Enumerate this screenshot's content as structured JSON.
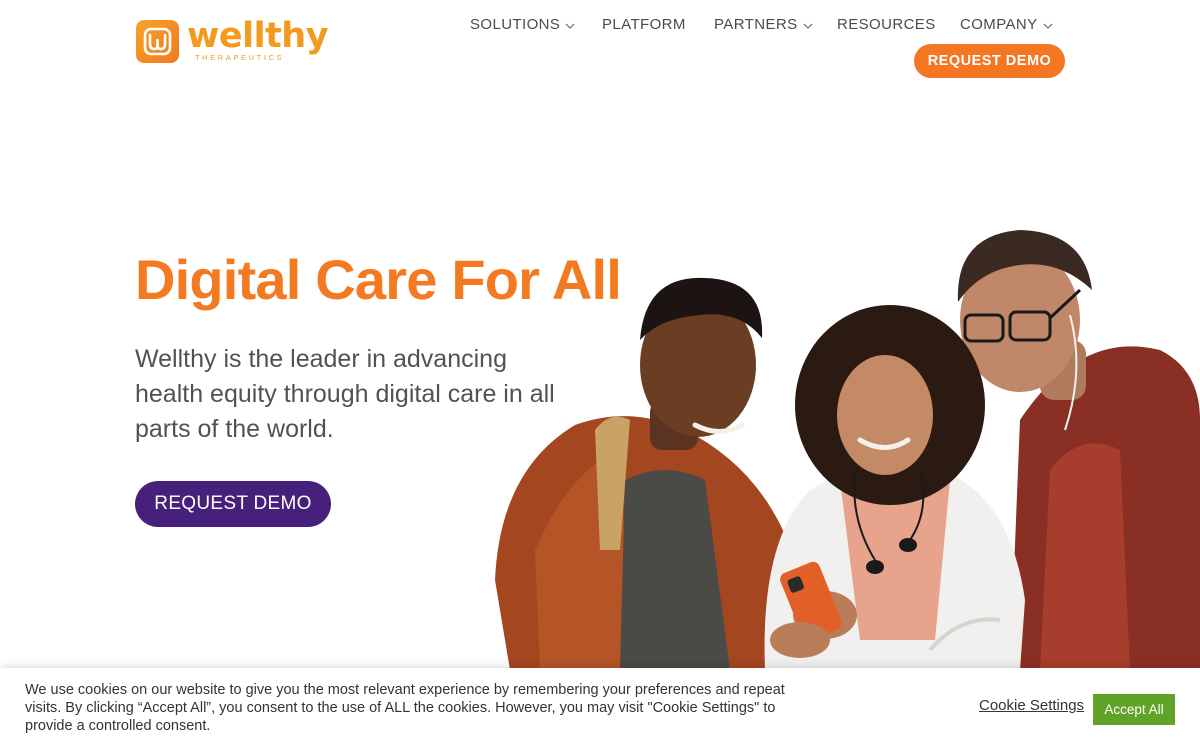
{
  "logo": {
    "word": "wellthy",
    "subtitle": "THERAPEUTICS",
    "icon": "wellthy-w-mark-icon"
  },
  "nav": {
    "items": [
      {
        "label": "SOLUTIONS",
        "has_dropdown": true
      },
      {
        "label": "PLATFORM",
        "has_dropdown": false
      },
      {
        "label": "PARTNERS",
        "has_dropdown": true
      },
      {
        "label": "RESOURCES",
        "has_dropdown": false
      },
      {
        "label": "COMPANY",
        "has_dropdown": true
      }
    ],
    "cta_label": "REQUEST DEMO"
  },
  "hero": {
    "title": "Digital Care For All",
    "description": "Wellthy is the leader in advancing health equity through digital care in all parts of the world.",
    "cta_label": "REQUEST DEMO"
  },
  "cookie": {
    "text": "We use cookies on our website to give you the most relevant experience by remembering your preferences and repeat visits. By clicking “Accept All”, you consent to the use of ALL the cookies. However, you may visit \"Cookie Settings\" to provide a controlled consent.",
    "settings_label": "Cookie Settings",
    "accept_label": "Accept All"
  },
  "colors": {
    "brand_orange": "#f47522",
    "title_orange": "#f47a22",
    "brand_purple": "#46207a",
    "accept_green": "#61a229"
  }
}
